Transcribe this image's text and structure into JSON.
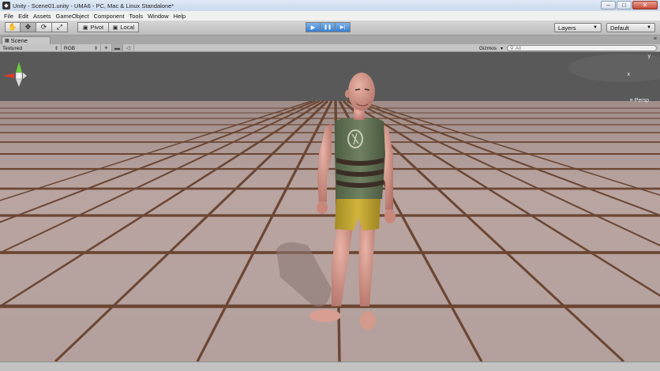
{
  "window": {
    "title": "Unity - Scene01.unity - UMA6 - PC, Mac & Linux Standalone*",
    "minimize": "–",
    "maximize": "□",
    "close": "✕"
  },
  "menu": [
    "File",
    "Edit",
    "Assets",
    "GameObject",
    "Component",
    "Tools",
    "Window",
    "Help"
  ],
  "toolbar": {
    "tools": [
      {
        "name": "hand-tool",
        "glyph": "✋"
      },
      {
        "name": "move-tool",
        "glyph": "✥"
      },
      {
        "name": "rotate-tool",
        "glyph": "⟳"
      },
      {
        "name": "scale-tool",
        "glyph": "⤢"
      }
    ],
    "pivot_label": "Pivot",
    "local_label": "Local",
    "play_glyph": "▶",
    "pause_glyph": "❚❚",
    "step_glyph": "▶|",
    "layers_label": "Layers",
    "layout_label": "Default"
  },
  "scene_tab": {
    "label": "Scene",
    "menu_glyph": "≡"
  },
  "scene_bar": {
    "render_mode": "Textured",
    "color_mode": "RGB",
    "gizmos_label": "Gizmos",
    "search_placeholder": "All"
  },
  "gizmo": {
    "y_label": "y",
    "x_label": "x",
    "projection_label": "Persp"
  },
  "colors": {
    "floor": "#b39b96",
    "grid_line": "#6b4633",
    "background": "#5a5a5a",
    "play_active": "#3a7fcf"
  }
}
